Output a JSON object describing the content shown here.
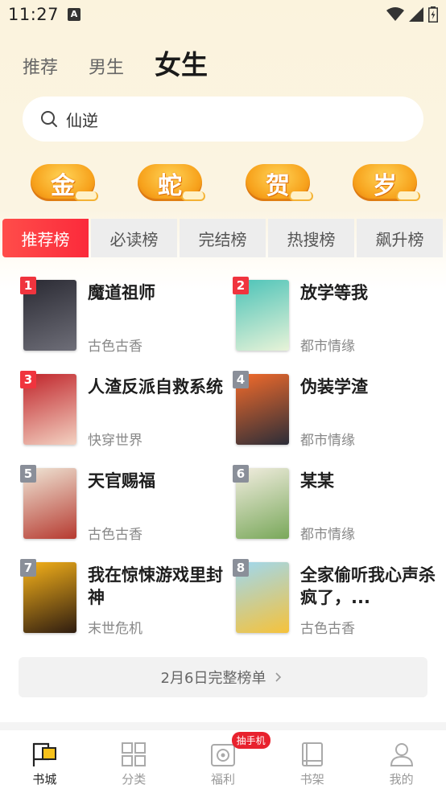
{
  "status_bar": {
    "time": "11:27",
    "app_icon_letter": "A"
  },
  "top_tabs": [
    {
      "label": "推荐",
      "active": false
    },
    {
      "label": "男生",
      "active": false
    },
    {
      "label": "女生",
      "active": true
    }
  ],
  "search": {
    "value": "仙逆"
  },
  "festive_badges": [
    "金",
    "蛇",
    "贺",
    "岁"
  ],
  "rank_tabs": [
    {
      "label": "推荐榜",
      "active": true
    },
    {
      "label": "必读榜",
      "active": false
    },
    {
      "label": "完结榜",
      "active": false
    },
    {
      "label": "热搜榜",
      "active": false
    },
    {
      "label": "飙升榜",
      "active": false
    }
  ],
  "books": [
    {
      "rank": "1",
      "title": "魔道祖师",
      "genre": "古色古香",
      "badge_color": "#f0343e",
      "cover_colors": [
        "#2a2a33",
        "#6e6e78"
      ]
    },
    {
      "rank": "2",
      "title": "放学等我",
      "genre": "都市情缘",
      "badge_color": "#f0343e",
      "cover_colors": [
        "#4cc3b8",
        "#e8f3d8"
      ]
    },
    {
      "rank": "3",
      "title": "人渣反派自救系统",
      "genre": "快穿世界",
      "badge_color": "#f0343e",
      "cover_colors": [
        "#c0242a",
        "#f3d2c2"
      ]
    },
    {
      "rank": "4",
      "title": "伪装学渣",
      "genre": "都市情缘",
      "badge_color": "#8a8f99",
      "cover_colors": [
        "#f36b2b",
        "#2b2d38"
      ]
    },
    {
      "rank": "5",
      "title": "天官赐福",
      "genre": "古色古香",
      "badge_color": "#8a8f99",
      "cover_colors": [
        "#efe6d6",
        "#b63a30"
      ]
    },
    {
      "rank": "6",
      "title": "某某",
      "genre": "都市情缘",
      "badge_color": "#8a8f99",
      "cover_colors": [
        "#f2ede0",
        "#79a85a"
      ]
    },
    {
      "rank": "7",
      "title": "我在惊悚游戏里封神",
      "genre": "末世危机",
      "badge_color": "#8a8f99",
      "cover_colors": [
        "#f6b21a",
        "#2e1c10"
      ]
    },
    {
      "rank": "8",
      "title": "全家偷听我心声杀疯了，...",
      "genre": "古色古香",
      "badge_color": "#8a8f99",
      "cover_colors": [
        "#9fd8f0",
        "#f6c23a"
      ]
    }
  ],
  "full_list": {
    "label": "2月6日完整榜单"
  },
  "bottom_nav": [
    {
      "label": "书城",
      "icon": "flag-icon",
      "active": true
    },
    {
      "label": "分类",
      "icon": "grid-icon",
      "active": false
    },
    {
      "label": "福利",
      "icon": "gift-icon",
      "active": false,
      "badge": "抽手机"
    },
    {
      "label": "书架",
      "icon": "book-icon",
      "active": false
    },
    {
      "label": "我的",
      "icon": "user-icon",
      "active": false
    }
  ]
}
